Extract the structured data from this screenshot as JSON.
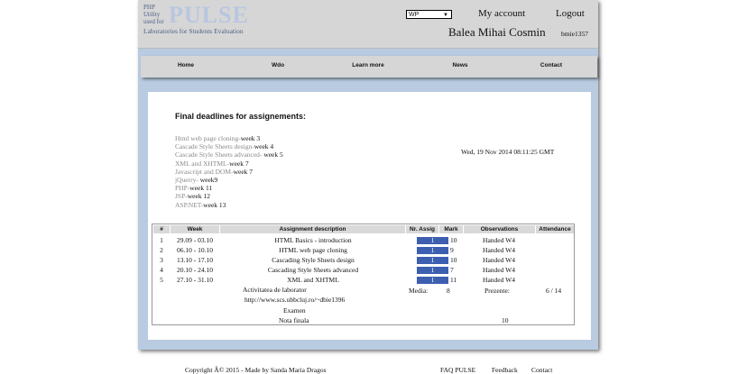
{
  "header": {
    "logo_small_lines": [
      "PHP",
      "Utility",
      "used for"
    ],
    "logo_big": "PULSE",
    "logo_tagline": "Laboratories for Students Evaluation",
    "select_value": "WP",
    "my_account": "My account",
    "logout": "Logout",
    "user_name": "Balea Mihai Cosmin",
    "user_id": "bmie1357"
  },
  "nav": [
    "Home",
    "Wdo",
    "Learn more",
    "News",
    "Contact"
  ],
  "main": {
    "title": "Final deadlines for assignements:",
    "deadlines": [
      {
        "name": "Html web page cloning-",
        "week": "week 3"
      },
      {
        "name": "Cascade Style Sheets design-",
        "week": "week 4"
      },
      {
        "name": "Cascade Style Sheets advanced- ",
        "week": "week 5"
      },
      {
        "name": "XML and XHTML-",
        "week": "week 7"
      },
      {
        "name": "Javascript and DOM-",
        "week": "week 7"
      },
      {
        "name": "jQuerry- ",
        "week": "week9"
      },
      {
        "name": "PHP-",
        "week": "week 11"
      },
      {
        "name": "JSP-",
        "week": "week 12"
      },
      {
        "name": "ASP.NET-",
        "week": "week 13"
      }
    ],
    "datetime": "Wed, 19 Nov 2014 08:11:25 GMT"
  },
  "grades": {
    "headers": [
      "#",
      "Week",
      "Assignment description",
      "Nr. Assig",
      "Mark",
      "Observations",
      "Attendance"
    ],
    "rows": [
      {
        "num": "1",
        "week": "29.09 - 03.10",
        "desc": "HTML Basics - introduction",
        "nr": "1",
        "mark": "10",
        "obs": "Handed W4"
      },
      {
        "num": "2",
        "week": "06.10 - 10.10",
        "desc": "HTML web page cloning",
        "nr": "1",
        "mark": "9",
        "obs": "Handed W4"
      },
      {
        "num": "3",
        "week": "13.10 - 17.10",
        "desc": "Cascading Style Sheets design",
        "nr": "1",
        "mark": "10",
        "obs": "Handed W4"
      },
      {
        "num": "4",
        "week": "20.10 - 24.10",
        "desc": "Cascading Style Sheets advanced",
        "nr": "1",
        "mark": "7",
        "obs": "Handed W4"
      },
      {
        "num": "5",
        "week": "27.10 - 31.10",
        "desc": "XML and XHTML",
        "nr": "1",
        "mark": "11",
        "obs": "Handed W4"
      }
    ],
    "activity_label": "Activitatea de laborator",
    "activity_url": "http://www.scs.ubbcluj.ro/~dbie1396",
    "media_label": "Media:",
    "media_value": "8",
    "prezente_label": "Prezente:",
    "prezente_value": "6 / 14",
    "examen_label": "Examen",
    "nota_label": "Nota finala",
    "nota_value": "10"
  },
  "footer": {
    "copyright": "Copyright Â© 2015 - Made by Sanda Maria Dragos",
    "links": [
      "FAQ PULSE",
      "Feedback",
      "Contact"
    ]
  },
  "colors": {
    "frame": "#b8cbe0",
    "header_bg": "#d6d6d6",
    "bar": "#3d5fb0",
    "logo_text": "#4a5f86"
  }
}
